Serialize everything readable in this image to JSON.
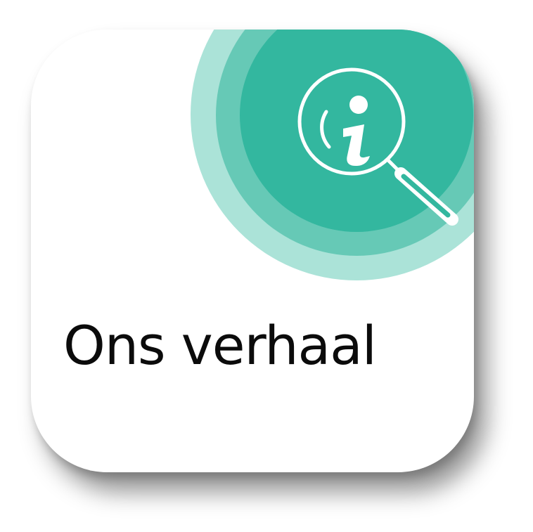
{
  "tile": {
    "title": "Ons verhaal",
    "icon": "info-magnifier-icon"
  },
  "colors": {
    "ring_outer": "#ABE3D8",
    "ring_mid": "#66C9B6",
    "ring_inner": "#33B79F",
    "icon_stroke": "#ffffff",
    "title_text": "#0b0b0b",
    "tile_background": "#ffffff"
  }
}
